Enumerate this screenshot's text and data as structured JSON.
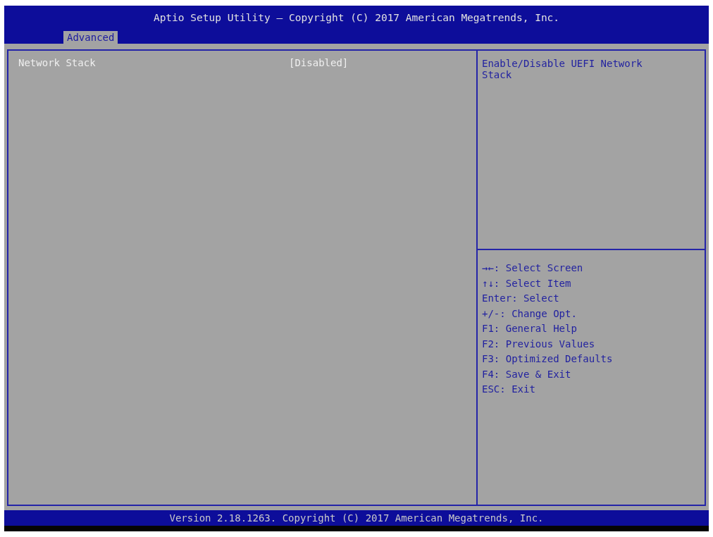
{
  "window": {
    "title": "Aptio Setup Utility – Copyright (C) 2017 American Megatrends, Inc."
  },
  "tabs": [
    {
      "label": "Advanced",
      "selected": true
    }
  ],
  "settings": [
    {
      "name": "Network Stack",
      "value": "[Disabled]",
      "selected": false
    }
  ],
  "help_text": "Enable/Disable UEFI Network Stack",
  "key_hints": [
    "→←: Select Screen",
    "↑↓: Select Item",
    "Enter: Select",
    "+/-: Change Opt.",
    "F1: General Help",
    "F2: Previous Values",
    "F3: Optimized Defaults",
    "F4: Save & Exit",
    "ESC: Exit"
  ],
  "status_bar": "Version 2.18.1263. Copyright (C) 2017 American Megatrends, Inc."
}
